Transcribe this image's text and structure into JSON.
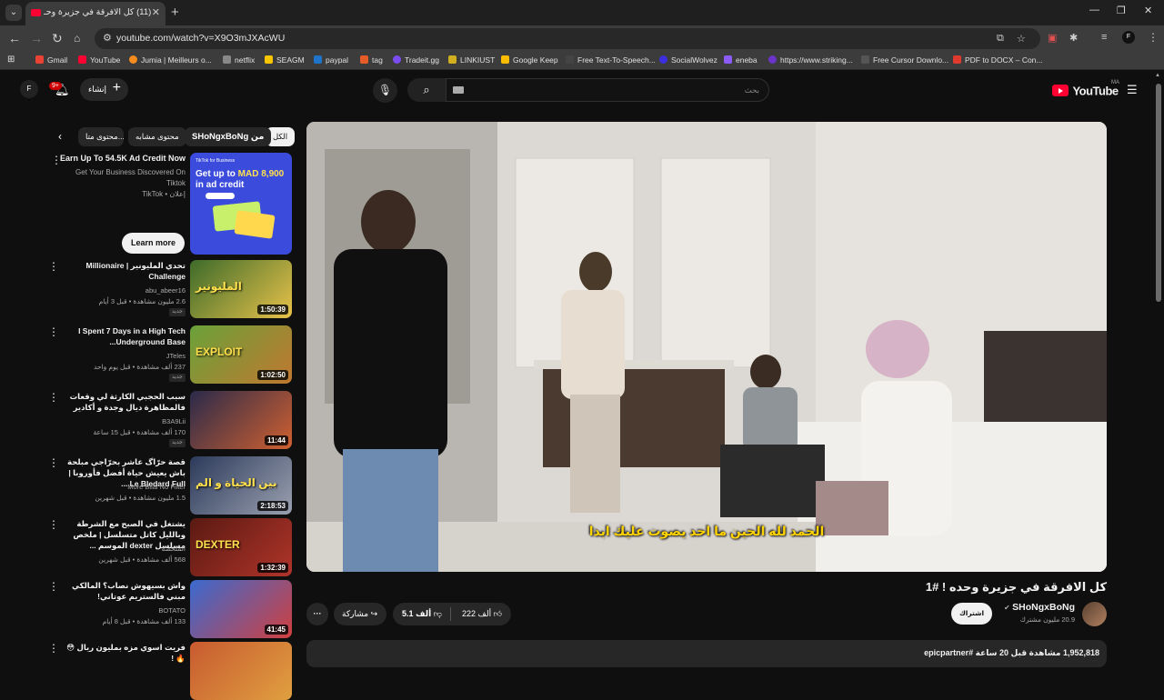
{
  "browser": {
    "tab_title": "(11) كل الافرقة في جزيرة وحـ",
    "tab_close": "✕",
    "new_tab": "+",
    "url": "youtube.com/watch?v=X9O3mJXAcWU",
    "window_controls": [
      "—",
      "❐",
      "✕"
    ],
    "bookmarks": [
      {
        "label": "Gmail",
        "color": "#ea4335"
      },
      {
        "label": "YouTube",
        "color": "#ff0033"
      },
      {
        "label": "Jumia | Meilleurs o...",
        "color": "#f68b1e"
      },
      {
        "label": "netflix",
        "color": "#888888"
      },
      {
        "label": "SEAGM",
        "color": "#f7c600"
      },
      {
        "label": "paypal",
        "color": "#1f73c8"
      },
      {
        "label": "tag",
        "color": "#e65c28"
      },
      {
        "label": "Tradeit.gg",
        "color": "#7b4df0"
      },
      {
        "label": "LINKIUST",
        "color": "#d0b020"
      },
      {
        "label": "Google Keep",
        "color": "#fbbc04"
      },
      {
        "label": "Free Text-To-Speech...",
        "color": "#444444"
      },
      {
        "label": "SocialWolvez",
        "color": "#3b2fe0"
      },
      {
        "label": "eneba",
        "color": "#8b5cf6"
      },
      {
        "label": "https://www.striking...",
        "color": "#6a34c8"
      },
      {
        "label": "Free Cursor Downlo...",
        "color": "#555555"
      },
      {
        "label": "PDF to DOCX – Con...",
        "color": "#e03a2f"
      }
    ]
  },
  "header": {
    "avatar_letter": "F",
    "notification_count": "9+",
    "create_label": "إنشاء",
    "search_placeholder": "بحث",
    "logo_word": "YouTube",
    "logo_country": "MA"
  },
  "chips": {
    "all": "الكل",
    "from_channel": "SHoNgxBoNg من",
    "similar": "محتوى مشابه",
    "related": "محتوى متا..."
  },
  "ad": {
    "title": "Earn Up To 54.5K Ad Credit Now",
    "description": "Get Your Business Discovered On Tiktok",
    "source": "TikTok • إعلان",
    "cta": "Learn more",
    "thumb_brand": "TikTok for Business",
    "thumb_headline_1": "Get up to",
    "thumb_headline_amount": "MAD 8,900",
    "thumb_headline_2": "in ad credit"
  },
  "recommendations": [
    {
      "title": "تحدي المليونير | Millionaire Challenge",
      "channel": "abu_abeer16",
      "meta": "2.6 مليون مشاهدة • قبل 3 أيام",
      "duration": "1:50:39",
      "badge": "جديد",
      "thumb_colors": [
        "#3d6b2a",
        "#e8c24a"
      ],
      "overlay": "المليونير"
    },
    {
      "title": "I Spent 7 Days in a High Tech Underground Base...",
      "channel": "JTeles",
      "meta": "237 ألف مشاهدة • قبل يوم واحد",
      "duration": "1:02:50",
      "badge": "جديد",
      "thumb_colors": [
        "#6aa23a",
        "#c07830"
      ],
      "overlay": "EXPLOIT"
    },
    {
      "title": "سبب الحجبي الكارثة لي وقعات فالمظاهرة ديال وجدة و أكادير",
      "channel": "B3A9Lii",
      "meta": "170 ألف مشاهدة • قبل 15 ساعة",
      "duration": "11:44",
      "badge": "جديد",
      "thumb_colors": [
        "#2a2a4a",
        "#d06030"
      ],
      "overlay": ""
    },
    {
      "title": "قصة حرّاگ عاشر بحرّاجي مبلحة باش يعيش حياة أفضل فأوروبا | Le Bledard Full ...",
      "channel": "More Bilal No Filter",
      "meta": "1.5 مليون مشاهدة • قبل شهرين",
      "duration": "2:18:53",
      "badge": "",
      "thumb_colors": [
        "#2c3a5a",
        "#9aa0b0"
      ],
      "overlay": "بين الحياة و الم"
    },
    {
      "title": "يشتغل في الصبح مع الشرطة وبالليل كاتل متسلسل | ملخص مسلسل dexter الموسم ...",
      "channel": "الملخصة",
      "meta": "568 ألف مشاهدة • قبل شهرين",
      "duration": "1:32:39",
      "badge": "",
      "thumb_colors": [
        "#5a1a12",
        "#b0342a"
      ],
      "overlay": "DEXTER"
    },
    {
      "title": "واش بسيهوش نصاب؟ المالكي مبني فالستريم عوتاني!",
      "channel": "BOTATO",
      "meta": "133 ألف مشاهدة • قبل 8 أيام",
      "duration": "41:45",
      "badge": "",
      "thumb_colors": [
        "#3a6ad0",
        "#d04040"
      ],
      "overlay": ""
    },
    {
      "title": "فريت اسوي مزه بمليون ريال 😳🔥 !",
      "channel": "",
      "meta": "",
      "duration": "",
      "badge": "",
      "thumb_colors": [
        "#c85a30",
        "#e0a040"
      ],
      "overlay": ""
    }
  ],
  "player": {
    "subtitle": "الحمد لله الحين ما احد يصوت عليك ابدا"
  },
  "video": {
    "title": "كل الافرقة في جزيرة وحده ! #1",
    "channel_name": "SHoNgxBoNg",
    "subscribers": "20.9 مليون مشترك",
    "subscribe_label": "اشتراك",
    "likes": "222 ألف",
    "dislikes": "5.1 ألف",
    "share_label": "مشاركة",
    "more": "···",
    "description_preview": "1,952,818 مشاهدة قبل 20 ساعة  #epicpartner"
  }
}
